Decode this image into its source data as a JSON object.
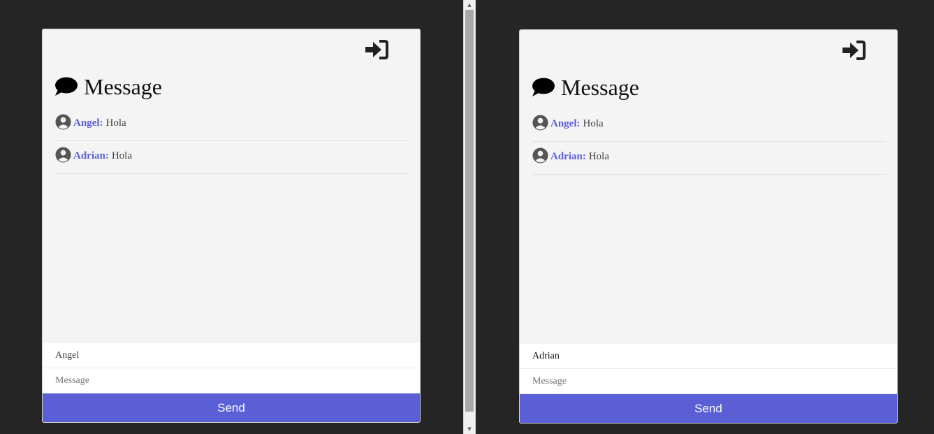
{
  "windows": [
    {
      "title": "Message",
      "logout_icon": "sign-in-icon",
      "chat_icon": "comment-icon",
      "messages": [
        {
          "author": "Angel:",
          "text": "Hola"
        },
        {
          "author": "Adrian:",
          "text": "Hola"
        }
      ],
      "form": {
        "name_value": "Angel",
        "message_value": "",
        "message_placeholder": "Message",
        "send_label": "Send"
      }
    },
    {
      "title": "Message",
      "logout_icon": "sign-in-icon",
      "chat_icon": "comment-icon",
      "messages": [
        {
          "author": "Angel:",
          "text": "Hola"
        },
        {
          "author": "Adrian:",
          "text": "Hola"
        }
      ],
      "form": {
        "name_value": "Adrian",
        "message_value": "",
        "message_placeholder": "Message",
        "send_label": "Send"
      }
    }
  ],
  "colors": {
    "accent": "#5b5fd6",
    "background": "#252525",
    "card": "#f4f4f4"
  }
}
